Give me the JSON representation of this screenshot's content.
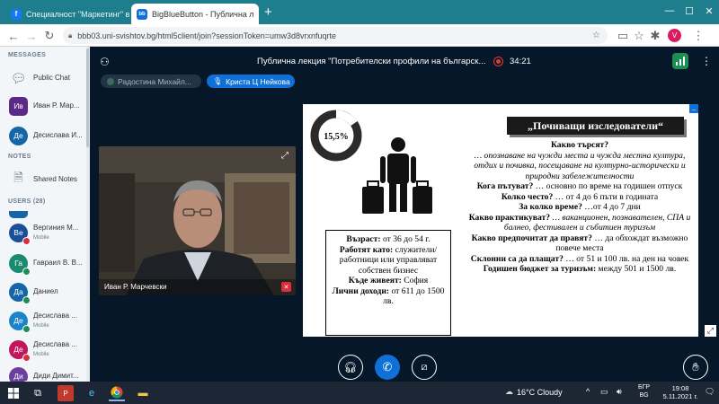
{
  "browser": {
    "tabs": [
      {
        "title": "Специалност \"Маркетинг\" випу",
        "active": false
      },
      {
        "title": "BigBlueButton - Публична л",
        "active": true
      }
    ],
    "new_tab_symbol": "+",
    "url": "bbb03.uni-svishtov.bg/html5client/join?sessionToken=umw3d8vrxnfuqrte",
    "profile_initial": "V"
  },
  "sidebar": {
    "messages_title": "MESSAGES",
    "public_chat": "Public Chat",
    "chats": [
      {
        "initials": "Ив",
        "name": "Иван Р. Мар...",
        "color": "#5b2a86"
      },
      {
        "initials": "Де",
        "name": "Десислава И...",
        "color": "#1566a8"
      }
    ],
    "notes_title": "NOTES",
    "shared_notes": "Shared Notes",
    "users_title": "USERS (28)",
    "users": [
      {
        "initials": "Ве",
        "name": "Вергиния М...",
        "sub": "Mobile",
        "color": "#1b4f9c",
        "badge": "red"
      },
      {
        "initials": "Га",
        "name": "Гаврaил В. В...",
        "sub": "",
        "color": "#1a8b6e",
        "badge": "green"
      },
      {
        "initials": "Да",
        "name": "Даниел",
        "sub": "",
        "color": "#1566a8",
        "badge": "green"
      },
      {
        "initials": "Де",
        "name": "Десислава ...",
        "sub": "Mobile",
        "color": "#1b84c8",
        "badge": "green"
      },
      {
        "initials": "Де",
        "name": "Десислава ...",
        "sub": "Mobile",
        "color": "#c2185b",
        "badge": "red"
      },
      {
        "initials": "Ди",
        "name": "Диди Димит...",
        "sub": "",
        "color": "#6a3fa0",
        "badge": "green"
      }
    ]
  },
  "header": {
    "title": "Публична лекция \"Потребителски профили на българск...",
    "timer": "34:21"
  },
  "talkers": [
    {
      "name": "Радостина Михайл...",
      "active": false
    },
    {
      "name": "Криста Ц Нейкова",
      "active": true
    }
  ],
  "webcam": {
    "name": "Иван Р. Марчевски"
  },
  "slide": {
    "donut_label": "15,5%",
    "donut_fraction": 0.155,
    "title": "„Почиващи изследователи“",
    "profile_box": [
      {
        "label": "Възраст:",
        "value": " от 36 до 54 г."
      },
      {
        "label": "Работят като:",
        "value": " служители/работници или управляват собствен бизнес"
      },
      {
        "label": "Къде живеят:",
        "value": " София"
      },
      {
        "label": "Лични доходи:",
        "value": " от 611  до 1500 лв."
      }
    ],
    "qa": [
      {
        "q": "Какво търсят?",
        "a": "… опознаване на чужди места и чужда местна култура, отдих  и почивка, посещаване на културно-исторически и природни забележителности",
        "italic": true
      },
      {
        "q": "Кога пътуват?",
        "a": " … основно по време на годишен отпуск",
        "italic": false
      },
      {
        "q": "Колко често?",
        "a": " … от 4 до 6 пъти в годината",
        "italic": false
      },
      {
        "q": "За колко време?",
        "a": " …от 4 до 7 дни",
        "italic": false
      },
      {
        "q": "Какво практикуват?",
        "a": " …  ваканционен, познавателен, СПА и балнео, фестивален и събитиен туризъм",
        "italic": true
      },
      {
        "q": "Какво предпочитат да правят?",
        "a": " … да обхождат възможно повече места",
        "italic": false
      },
      {
        "q": "Склонни са да плащат?",
        "a": " … от 51 и 100 лв. на ден на човек",
        "italic": false
      },
      {
        "q": "Годишен бюджет за туризъм:",
        "a": " между 501 и 1500 лв.",
        "italic": false
      }
    ]
  },
  "taskbar": {
    "weather": "16°C  Cloudy",
    "lang": "БГР",
    "lang2": "BG",
    "time": "19:08",
    "date": "5.11.2021 г."
  },
  "colors": {
    "bbb_blue": "#0f70d7",
    "tab_bar": "#1f7e8e",
    "bg_dark": "#06172a"
  }
}
